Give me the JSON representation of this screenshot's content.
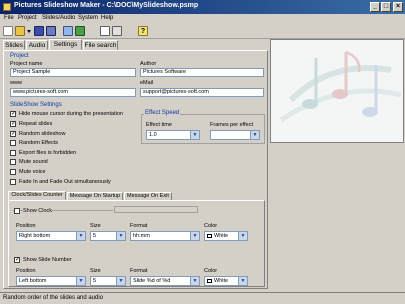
{
  "window": {
    "title": "Pictures Slideshow Maker - C:\\DOC\\MySlideshow.psmp",
    "min": "_",
    "max": "□",
    "close": "×"
  },
  "menu": [
    "File",
    "Project",
    "Slides/Audio",
    "System",
    "Help"
  ],
  "toolbar": {
    "help_label": "?"
  },
  "tabs": [
    "Slides",
    "Audio",
    "Settings",
    "File search"
  ],
  "project": {
    "section_title": "Project",
    "name_label": "Project name",
    "name_value": "Project Sample",
    "author_label": "Author",
    "author_value": "Pictures Software",
    "www_label": "www",
    "www_value": "www.pictures-soft.com",
    "email_label": "eMail",
    "email_value": "support@pictures-soft.com"
  },
  "slideshow_settings": {
    "section_title": "SlideShow Settings",
    "options": [
      {
        "label": "Hide mouse cursor during the presentation",
        "checked": true
      },
      {
        "label": "Repeat slides",
        "checked": true
      },
      {
        "label": "Random slideshow",
        "checked": true
      },
      {
        "label": "Random Effects",
        "checked": false
      },
      {
        "label": "Export files is forbidden",
        "checked": false
      },
      {
        "label": "Mute sound",
        "checked": false
      },
      {
        "label": "Mute voice",
        "checked": false
      },
      {
        "label": "Fade In and Fade Out simultaneously",
        "checked": false
      }
    ]
  },
  "effect_speed": {
    "title": "Effect Speed",
    "effect_time_label": "Effect time",
    "effect_time_value": "1.0",
    "frames_label": "Frames per effect",
    "frames_value": ""
  },
  "subtabs": [
    "Clock/Slides Counter",
    "Message On Startup",
    "Message On Exit"
  ],
  "clock": {
    "show_label": "Show Clock",
    "checked": false,
    "position_label": "Position",
    "position_value": "Right bottom",
    "size_label": "Size",
    "size_value": "5",
    "format_label": "Format",
    "format_value": "hh:mm",
    "color_label": "Color",
    "color_value": "White"
  },
  "slide_number": {
    "show_label": "Show Slide Number",
    "checked": true,
    "position_label": "Position",
    "position_value": "Left bottom",
    "size_label": "Size",
    "size_value": "5",
    "format_label": "Format",
    "format_value": "Slide %d of %d",
    "color_label": "Color",
    "color_value": "White"
  },
  "status_bar": {
    "text": "Random order of the slides and audio"
  }
}
